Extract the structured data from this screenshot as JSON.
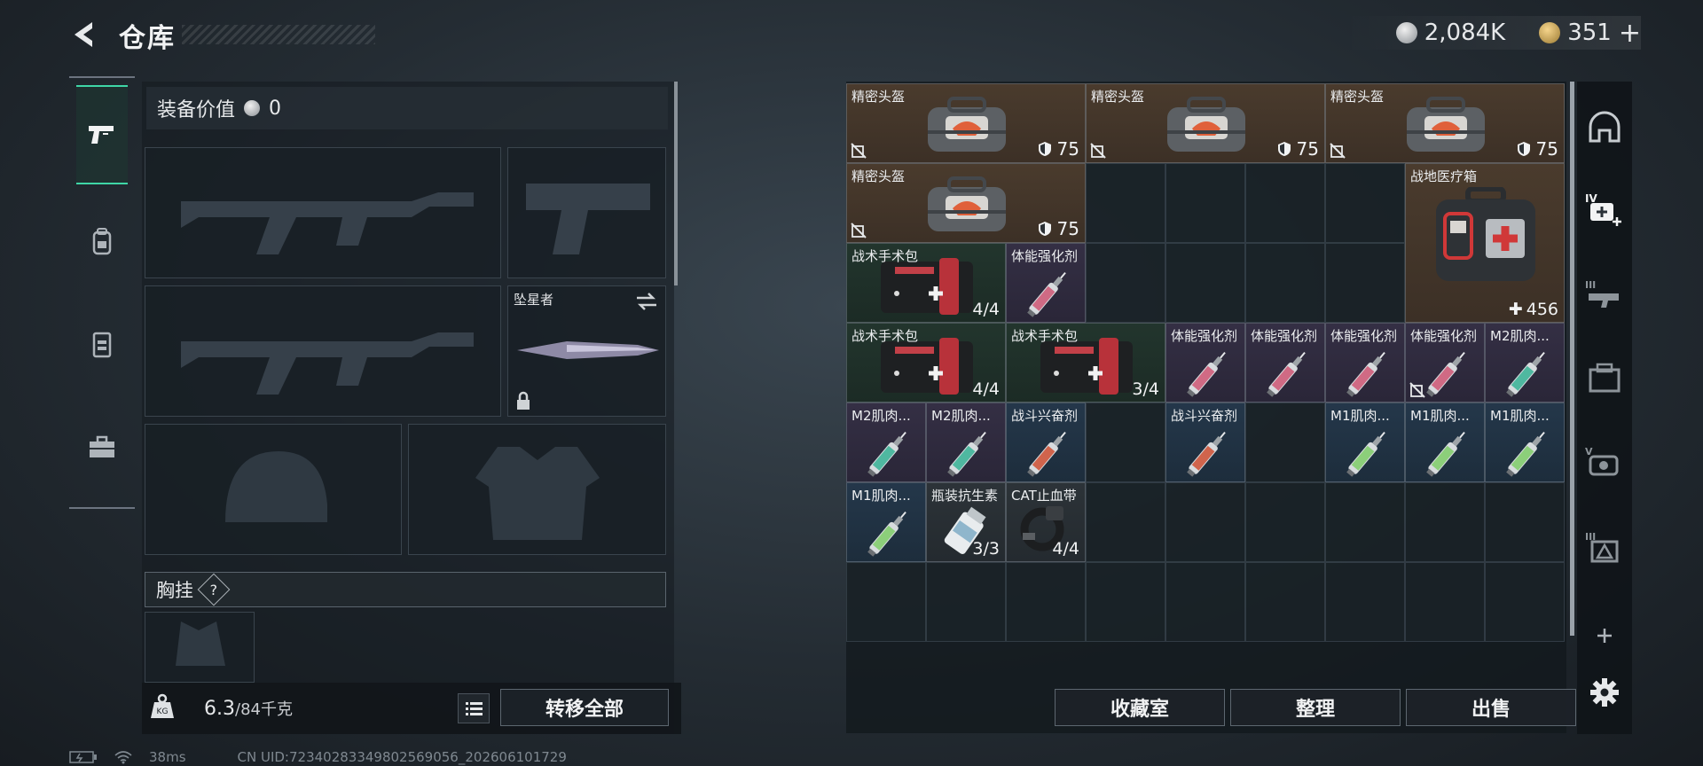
{
  "header": {
    "title": "仓库",
    "currency_1": "2,084K",
    "currency_2": "351",
    "currency_2_plus": "+"
  },
  "left_tabs": [
    {
      "name": "weapons",
      "icon": "pistol-icon",
      "active": true
    },
    {
      "name": "gear",
      "icon": "backpack-icon",
      "active": false
    },
    {
      "name": "vest",
      "icon": "vest-icon",
      "active": false
    },
    {
      "name": "case",
      "icon": "toolbox-icon",
      "active": false
    }
  ],
  "equipment": {
    "value_label": "装备价值",
    "value": "0",
    "melee_label": "坠星者",
    "chest_label": "胸挂",
    "chest_help": "?",
    "weight_value": "6.3",
    "weight_max": "/84千克",
    "transfer_all": "转移全部"
  },
  "storage": {
    "items": [
      {
        "name": "精密头盔",
        "kind": "bag",
        "color": "brown",
        "dur": "75",
        "noins": true,
        "c": 0,
        "r": 0,
        "w": 3,
        "h": 1
      },
      {
        "name": "精密头盔",
        "kind": "bag",
        "color": "brown",
        "dur": "75",
        "noins": true,
        "c": 3,
        "r": 0,
        "w": 3,
        "h": 1
      },
      {
        "name": "精密头盔",
        "kind": "bag",
        "color": "brown",
        "dur": "75",
        "noins": true,
        "c": 6,
        "r": 0,
        "w": 3,
        "h": 1
      },
      {
        "name": "精密头盔",
        "kind": "bag",
        "color": "brown",
        "dur": "75",
        "noins": true,
        "c": 0,
        "r": 1,
        "w": 3,
        "h": 1
      },
      {
        "name": "战地医疗箱",
        "kind": "medbox",
        "color": "brown",
        "count": "456",
        "plus": true,
        "c": 7,
        "r": 1,
        "w": 2,
        "h": 2
      },
      {
        "name": "战术手术包",
        "kind": "kit",
        "color": "green",
        "count": "4/4",
        "c": 0,
        "r": 2,
        "w": 2,
        "h": 1
      },
      {
        "name": "体能强化剂",
        "kind": "syringe",
        "color": "purple",
        "syr": "#d06a84",
        "c": 2,
        "r": 2,
        "w": 1,
        "h": 1
      },
      {
        "name": "战术手术包",
        "kind": "kit",
        "color": "green",
        "count": "4/4",
        "c": 0,
        "r": 3,
        "w": 2,
        "h": 1
      },
      {
        "name": "战术手术包",
        "kind": "kit",
        "color": "green",
        "count": "3/4",
        "c": 2,
        "r": 3,
        "w": 2,
        "h": 1
      },
      {
        "name": "体能强化剂",
        "kind": "syringe",
        "color": "purple",
        "syr": "#d06a84",
        "c": 4,
        "r": 3,
        "w": 1,
        "h": 1
      },
      {
        "name": "体能强化剂",
        "kind": "syringe",
        "color": "purple",
        "syr": "#d06a84",
        "c": 5,
        "r": 3,
        "w": 1,
        "h": 1
      },
      {
        "name": "体能强化剂",
        "kind": "syringe",
        "color": "purple",
        "syr": "#d06a84",
        "c": 6,
        "r": 3,
        "w": 1,
        "h": 1
      },
      {
        "name": "体能强化剂",
        "kind": "syringe",
        "color": "purple",
        "syr": "#d06a84",
        "noins": true,
        "c": 7,
        "r": 3,
        "w": 1,
        "h": 1
      },
      {
        "name": "M2肌肉...",
        "kind": "syringe",
        "color": "purple",
        "syr": "#4fb8a0",
        "c": 8,
        "r": 3,
        "w": 1,
        "h": 1
      },
      {
        "name": "M2肌肉...",
        "kind": "syringe",
        "color": "purple",
        "syr": "#4fb8a0",
        "c": 0,
        "r": 4,
        "w": 1,
        "h": 1
      },
      {
        "name": "M2肌肉...",
        "kind": "syringe",
        "color": "purple",
        "syr": "#4fb8a0",
        "c": 1,
        "r": 4,
        "w": 1,
        "h": 1
      },
      {
        "name": "战斗兴奋剂",
        "kind": "syringe",
        "color": "blue",
        "syr": "#d0644c",
        "c": 2,
        "r": 4,
        "w": 1,
        "h": 1
      },
      {
        "name": "战斗兴奋剂",
        "kind": "syringe",
        "color": "blue",
        "syr": "#d0644c",
        "c": 4,
        "r": 4,
        "w": 1,
        "h": 1
      },
      {
        "name": "M1肌肉...",
        "kind": "syringe",
        "color": "blue",
        "syr": "#8ccf7a",
        "c": 6,
        "r": 4,
        "w": 1,
        "h": 1
      },
      {
        "name": "M1肌肉...",
        "kind": "syringe",
        "color": "blue",
        "syr": "#8ccf7a",
        "c": 7,
        "r": 4,
        "w": 1,
        "h": 1
      },
      {
        "name": "M1肌肉...",
        "kind": "syringe",
        "color": "blue",
        "syr": "#8ccf7a",
        "c": 8,
        "r": 4,
        "w": 1,
        "h": 1
      },
      {
        "name": "M1肌肉...",
        "kind": "syringe",
        "color": "blue",
        "syr": "#8ccf7a",
        "c": 0,
        "r": 5,
        "w": 1,
        "h": 1
      },
      {
        "name": "瓶装抗生素",
        "kind": "bottle",
        "color": "gray",
        "count": "3/3",
        "c": 1,
        "r": 5,
        "w": 1,
        "h": 1
      },
      {
        "name": "CAT止血带",
        "kind": "tourniquet",
        "color": "gray",
        "count": "4/4",
        "c": 2,
        "r": 5,
        "w": 1,
        "h": 1
      }
    ],
    "collection_label": "收藏室",
    "sort_label": "整理",
    "sell_label": "出售"
  },
  "right_tabs": [
    "dome-icon",
    "iv-medical-plus-icon",
    "iii-rifle-icon",
    "box-icon",
    "v-armor-icon",
    "iii-tactical-icon",
    "add-icon",
    "gear-icon"
  ],
  "status": {
    "ping": "38ms",
    "uid": "CN UID:72340283349802569056_202606101729"
  },
  "colors": {
    "accent": "#3fd6a6",
    "brown_tier": "#4a3b2d",
    "green_tier": "#22352d",
    "purple_tier": "#342f44",
    "blue_tier": "#24374a"
  }
}
